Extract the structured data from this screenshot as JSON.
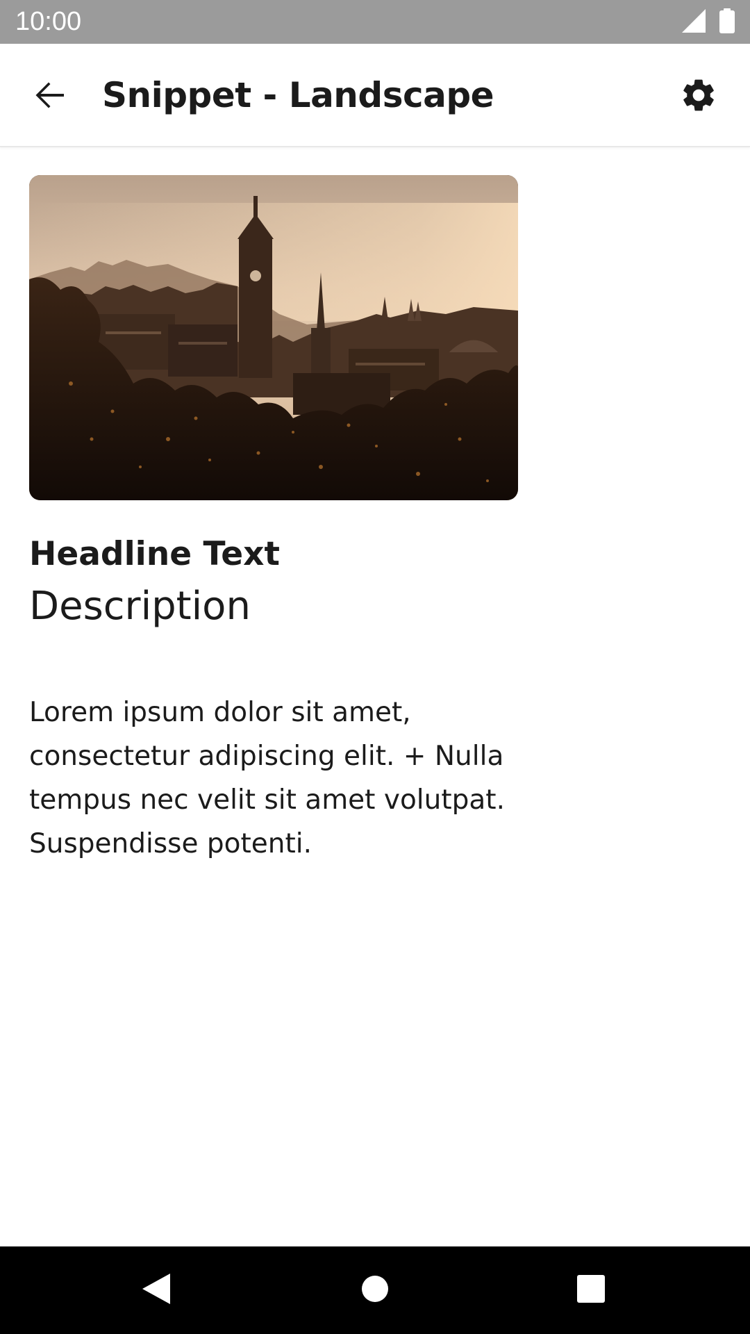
{
  "status_bar": {
    "time": "10:00",
    "icons": [
      "signal-icon",
      "battery-icon"
    ]
  },
  "app_bar": {
    "title": "Snippet - Landscape",
    "back_icon": "arrow-back-icon",
    "settings_icon": "gear-icon"
  },
  "content": {
    "image": "city-skyline-sunset-photo",
    "headline": "Headline Text",
    "description": "Description",
    "body": "Lorem ipsum dolor sit amet, consectetur adipiscing elit. + Nulla tempus nec velit sit amet volutpat. Suspendisse potenti."
  },
  "nav_bar": {
    "icons": [
      "nav-back-icon",
      "nav-home-icon",
      "nav-recents-icon"
    ]
  },
  "colors": {
    "status_bar": "#9b9b9b",
    "text": "#1b1b1b",
    "nav_bar": "#000000"
  }
}
